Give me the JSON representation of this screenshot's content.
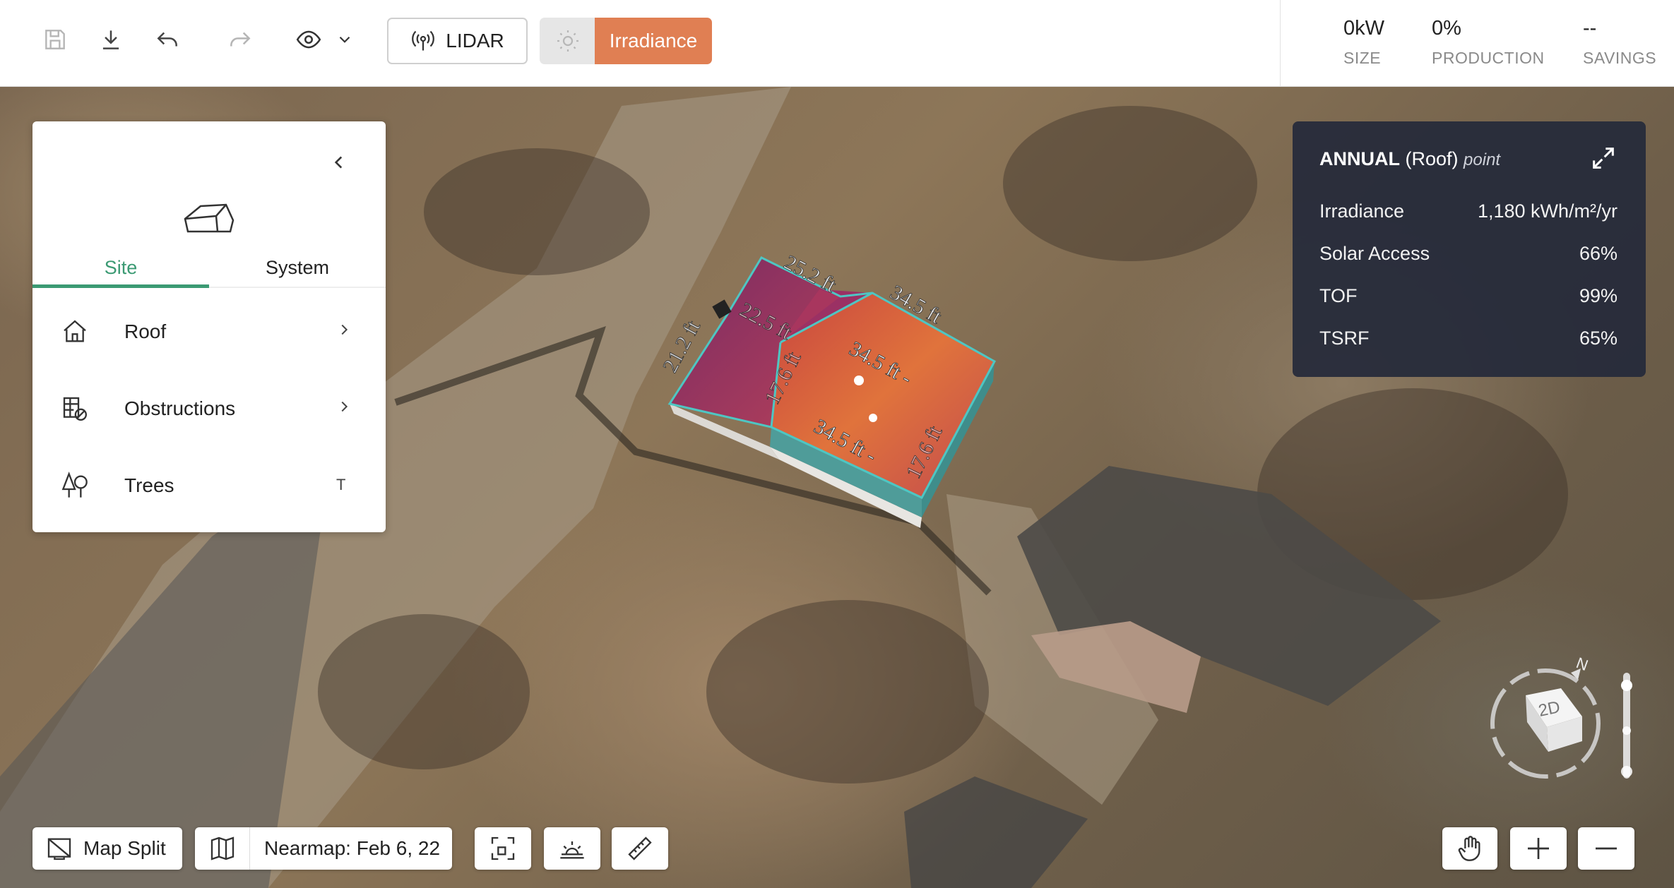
{
  "toolbar": {
    "lidar_label": "LIDAR",
    "irradiance_label": "Irradiance",
    "stats": [
      {
        "value": "0kW",
        "label": "SIZE"
      },
      {
        "value": "0%",
        "label": "PRODUCTION"
      },
      {
        "value": "--",
        "label": "SAVINGS"
      }
    ],
    "icons": [
      "save-icon",
      "download-icon",
      "undo-icon",
      "redo-icon",
      "eye-icon",
      "chevron-down-icon",
      "lidar-icon",
      "sun-icon"
    ],
    "accent_color": "#e07f53"
  },
  "panel": {
    "tabs": [
      {
        "label": "Site"
      },
      {
        "label": "System"
      }
    ],
    "active_tab_color": "#3b9a73",
    "items": [
      {
        "label": "Roof",
        "icon": "house-icon",
        "right": "chevron"
      },
      {
        "label": "Obstructions",
        "icon": "obstruction-icon",
        "right": "chevron"
      },
      {
        "label": "Trees",
        "icon": "trees-icon",
        "right": "T"
      }
    ]
  },
  "info": {
    "title_bold": "ANNUAL",
    "title_normal": "(Roof)",
    "title_italic": "point",
    "rows": [
      {
        "label": "Irradiance",
        "value": "1,180 kWh/m²/yr"
      },
      {
        "label": "Solar Access",
        "value": "66%"
      },
      {
        "label": "TOF",
        "value": "99%"
      },
      {
        "label": "TSRF",
        "value": "65%"
      }
    ]
  },
  "map": {
    "dimensions": [
      "25.2 ft",
      "34.5 ft",
      "22.5 ft",
      "34.5 ft -",
      "17.6 ft",
      "34.5 ft -",
      "17.6 ft",
      "21.2 ft"
    ]
  },
  "bottom": {
    "map_split_label": "Map Split",
    "imagery_label": "Nearmap: Feb 6, 22"
  },
  "compass": {
    "mode_label": "2D",
    "north_label": "N"
  }
}
